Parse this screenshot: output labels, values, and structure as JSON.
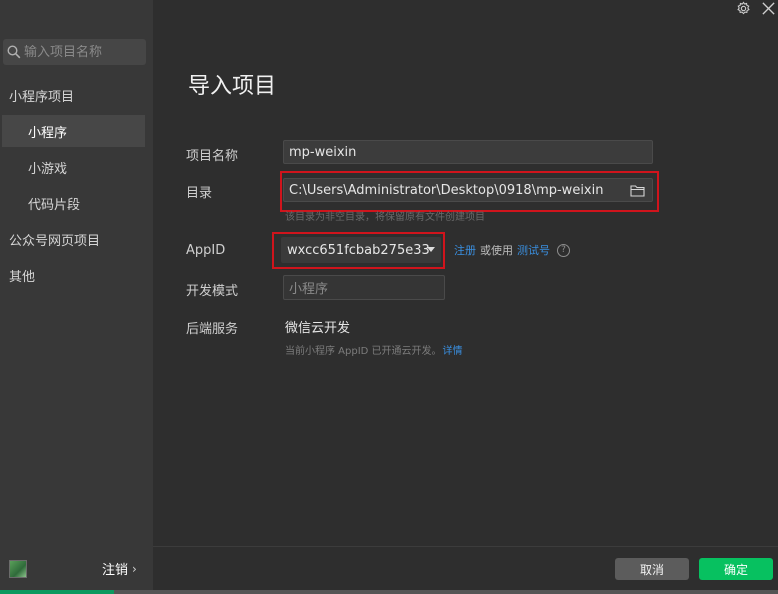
{
  "sidebar": {
    "search_placeholder": "输入项目名称",
    "items": [
      {
        "label": "小程序项目"
      },
      {
        "label": "小程序"
      },
      {
        "label": "小游戏"
      },
      {
        "label": "代码片段"
      },
      {
        "label": "公众号网页项目"
      },
      {
        "label": "其他"
      }
    ],
    "logout_label": "注销",
    "logout_chevron": "›"
  },
  "main": {
    "title": "导入项目",
    "project_name_label": "项目名称",
    "project_name_value": "mp-weixin",
    "directory_label": "目录",
    "directory_value": "C:\\Users\\Administrator\\Desktop\\0918\\mp-weixin",
    "directory_hint": "该目录为非空目录，将保留原有文件创建项目",
    "appid_label": "AppID",
    "appid_value": "wxcc651fcbab275e33",
    "register_link": "注册",
    "or_use_text": "或使用",
    "test_account_link": "测试号",
    "question_mark": "?",
    "dev_mode_label": "开发模式",
    "dev_mode_value": "小程序",
    "backend_label": "后端服务",
    "backend_value": "微信云开发",
    "backend_hint": "当前小程序 AppID 已开通云开发。",
    "backend_detail_link": "详情"
  },
  "footer": {
    "cancel_label": "取消",
    "ok_label": "确定"
  },
  "colors": {
    "accent_green": "#07c160",
    "link_blue": "#3a8fe0",
    "highlight_red": "#d0141c"
  }
}
